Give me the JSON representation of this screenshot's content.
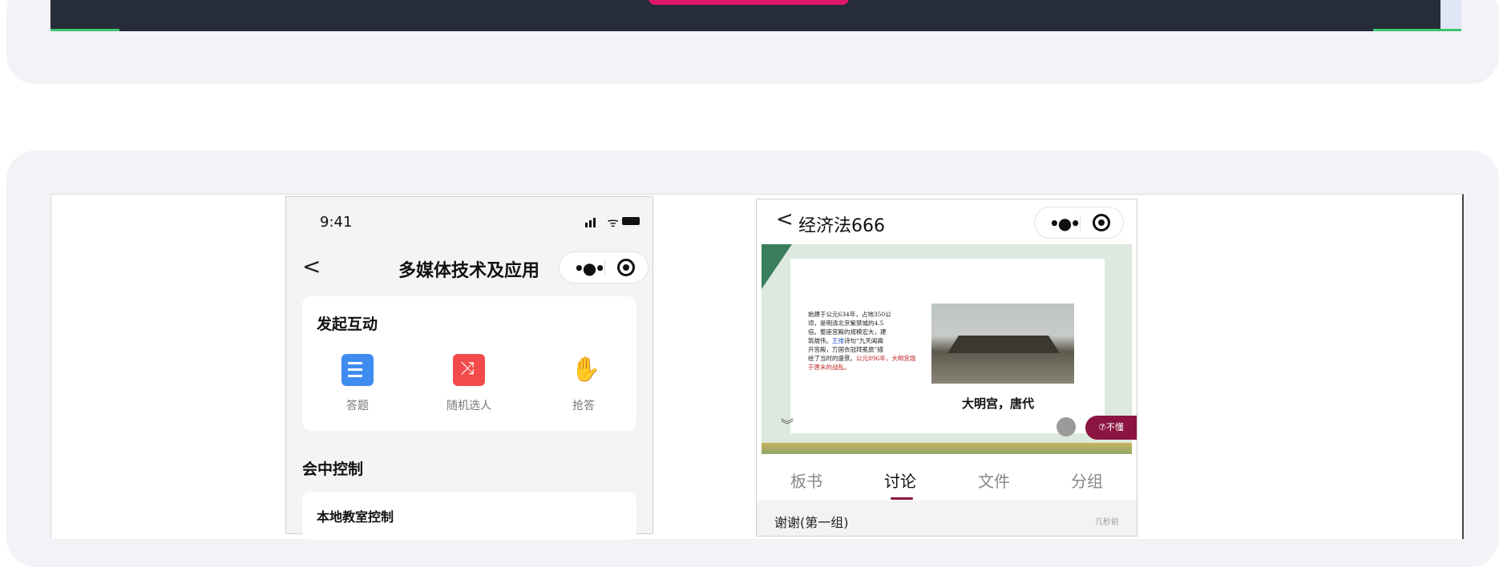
{
  "phone1": {
    "status_time": "9:41",
    "title": "多媒体技术及应用",
    "back_glyph": "<",
    "capsule_dots": "•●•",
    "section_interact": "发起互动",
    "actions": [
      {
        "label": "答题",
        "icon": "answer-icon"
      },
      {
        "label": "随机选人",
        "icon": "random-pick-icon"
      },
      {
        "label": "抢答",
        "icon": "raise-hand-icon"
      }
    ],
    "section_control": "会中控制",
    "local_control": "本地教室控制"
  },
  "phone2": {
    "title": "经济法666",
    "back_glyph": "<",
    "capsule_dots": "•●•",
    "slide": {
      "text_line1": "始建于公元634年，占地350公",
      "text_line2": "顷，是明清北京紫禁城的4.5",
      "text_line3": "倍。整座宫殿的规模宏大，建",
      "text_line4": "筑雄伟。",
      "text_highlight": "王维",
      "text_line4b": "诗句“九天阊阖",
      "text_line5": "开宫殿，万国衣冠拜冕旒”描",
      "text_line6": "绘了当时的盛景。",
      "text_red": "公元896年，大明宫毁于唐末的战乱。",
      "caption": "大明宫，唐代",
      "dont_understand": "⑦不懂"
    },
    "tabs": [
      "板书",
      "讨论",
      "文件",
      "分组"
    ],
    "active_tab": "讨论",
    "message": {
      "name": "谢谢(第一组)",
      "time": "几秒前"
    }
  },
  "colors": {
    "accent_pink": "#e0186a",
    "accent_maroon": "#8b1540",
    "dark_strip": "#262c3a",
    "green": "#3ec46d"
  }
}
